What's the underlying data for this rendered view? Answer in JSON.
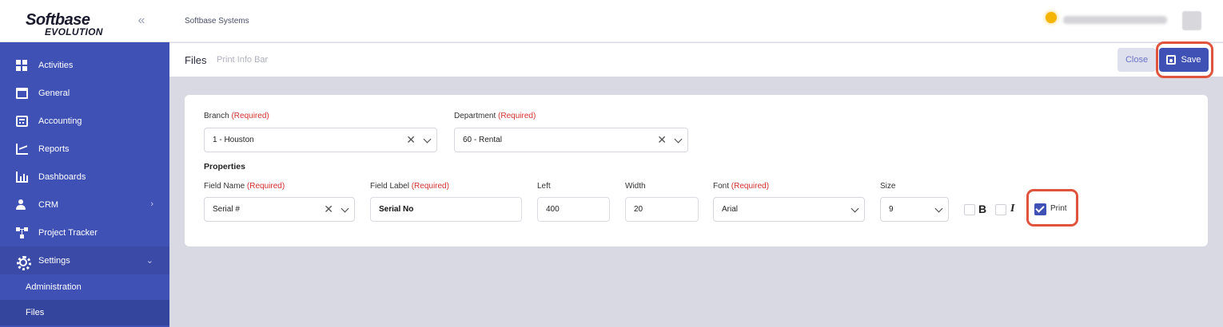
{
  "app": {
    "logo_line1": "Softbase",
    "logo_line2": "EVOLUTION",
    "company": "Softbase Systems"
  },
  "sidebar": {
    "items": [
      {
        "label": "Activities",
        "icon": "grid-icon"
      },
      {
        "label": "General",
        "icon": "archive-icon"
      },
      {
        "label": "Accounting",
        "icon": "calculator-icon"
      },
      {
        "label": "Reports",
        "icon": "line-chart-icon"
      },
      {
        "label": "Dashboards",
        "icon": "bar-chart-icon"
      },
      {
        "label": "CRM",
        "icon": "user-icon"
      },
      {
        "label": "Project Tracker",
        "icon": "hierarchy-icon"
      },
      {
        "label": "Settings",
        "icon": "gear-icon"
      }
    ],
    "sub_items": [
      {
        "label": "Administration"
      },
      {
        "label": "Files"
      }
    ]
  },
  "page": {
    "title": "Files",
    "subtitle": "Print Info Bar",
    "close_label": "Close",
    "save_label": "Save"
  },
  "form": {
    "branch_label": "Branch",
    "branch_value": "1 - Houston",
    "department_label": "Department",
    "department_value": "60 - Rental",
    "required_text": "(Required)",
    "properties_title": "Properties",
    "field_name_label": "Field Name",
    "field_name_value": "Serial #",
    "field_label_label": "Field Label",
    "field_label_value": "Serial No",
    "left_label": "Left",
    "left_value": "400",
    "width_label": "Width",
    "width_value": "20",
    "font_label": "Font",
    "font_value": "Arial",
    "size_label": "Size",
    "size_value": "9",
    "bold_glyph": "B",
    "italic_glyph": "I",
    "print_label": "Print"
  },
  "colors": {
    "primary": "#3f51b5",
    "highlight": "#e0533d",
    "required": "#d32f2f"
  }
}
